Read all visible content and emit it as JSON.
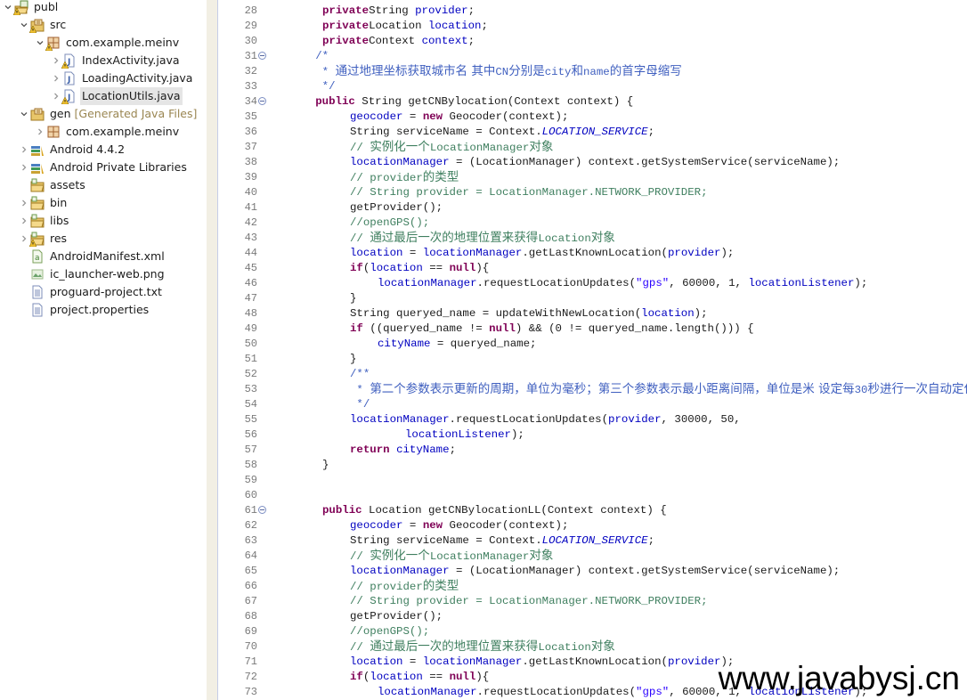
{
  "explorer": {
    "items": [
      {
        "label": "publ",
        "decoration": "",
        "depth": 0,
        "expanded": true,
        "icon": "android-project-icon",
        "warning": true
      },
      {
        "label": "src",
        "decoration": "",
        "depth": 1,
        "expanded": true,
        "icon": "source-folder-icon",
        "warning": true
      },
      {
        "label": "com.example.meinv",
        "decoration": "",
        "depth": 2,
        "expanded": true,
        "icon": "package-icon",
        "warning": true
      },
      {
        "label": "IndexActivity.java",
        "decoration": "",
        "depth": 3,
        "expanded": false,
        "icon": "java-file-icon",
        "warning": true
      },
      {
        "label": "LoadingActivity.java",
        "decoration": "",
        "depth": 3,
        "expanded": false,
        "icon": "java-file-icon",
        "warning": false
      },
      {
        "label": "LocationUtils.java",
        "decoration": "",
        "depth": 3,
        "expanded": false,
        "icon": "java-file-icon",
        "warning": true,
        "selected": true
      },
      {
        "label": "gen",
        "decoration": "[Generated Java Files]",
        "depth": 1,
        "expanded": true,
        "icon": "source-folder-icon",
        "warning": false
      },
      {
        "label": "com.example.meinv",
        "decoration": "",
        "depth": 2,
        "expanded": false,
        "icon": "package-icon",
        "warning": false
      },
      {
        "label": "Android 4.4.2",
        "decoration": "",
        "depth": 1,
        "expanded": false,
        "icon": "library-icon",
        "warning": false
      },
      {
        "label": "Android Private Libraries",
        "decoration": "",
        "depth": 1,
        "expanded": false,
        "icon": "library-icon",
        "warning": false
      },
      {
        "label": "assets",
        "decoration": "",
        "depth": 1,
        "expanded": null,
        "icon": "folder-icon",
        "warning": false
      },
      {
        "label": "bin",
        "decoration": "",
        "depth": 1,
        "expanded": false,
        "icon": "folder-icon",
        "warning": false
      },
      {
        "label": "libs",
        "decoration": "",
        "depth": 1,
        "expanded": false,
        "icon": "folder-icon",
        "warning": false
      },
      {
        "label": "res",
        "decoration": "",
        "depth": 1,
        "expanded": false,
        "icon": "folder-icon",
        "warning": true
      },
      {
        "label": "AndroidManifest.xml",
        "decoration": "",
        "depth": 1,
        "expanded": null,
        "icon": "xml-file-icon",
        "warning": false
      },
      {
        "label": "ic_launcher-web.png",
        "decoration": "",
        "depth": 1,
        "expanded": null,
        "icon": "image-file-icon",
        "warning": false
      },
      {
        "label": "proguard-project.txt",
        "decoration": "",
        "depth": 1,
        "expanded": null,
        "icon": "text-file-icon",
        "warning": false
      },
      {
        "label": "project.properties",
        "decoration": "",
        "depth": 1,
        "expanded": null,
        "icon": "text-file-icon",
        "warning": false
      }
    ]
  },
  "editor": {
    "lines": [
      {
        "n": "28",
        "fold": false,
        "indent": 1,
        "tokens": [
          [
            "kw",
            "private"
          ],
          [
            "",
            "String "
          ],
          [
            "fld",
            "provider"
          ],
          [
            "",
            ";"
          ]
        ]
      },
      {
        "n": "29",
        "fold": false,
        "indent": 1,
        "tokens": [
          [
            "kw",
            "private"
          ],
          [
            "",
            "Location "
          ],
          [
            "fld",
            "location"
          ],
          [
            "",
            ";"
          ]
        ]
      },
      {
        "n": "30",
        "fold": false,
        "indent": 1,
        "tokens": [
          [
            "kw",
            "private"
          ],
          [
            "",
            "Context "
          ],
          [
            "fld",
            "context"
          ],
          [
            "",
            ";"
          ]
        ]
      },
      {
        "n": "31",
        "fold": true,
        "indent": 0.75,
        "tokens": [
          [
            "jd",
            "/*"
          ]
        ]
      },
      {
        "n": "32",
        "fold": false,
        "indent": 0.75,
        "tokens": [
          [
            "jd",
            " * "
          ],
          [
            "jdcjk",
            "通过地理坐标获取城市名 其中"
          ],
          [
            "jd",
            "CN"
          ],
          [
            "jdcjk",
            "分别是"
          ],
          [
            "jd",
            "city"
          ],
          [
            "jdcjk",
            "和"
          ],
          [
            "jd",
            "name"
          ],
          [
            "jdcjk",
            "的首字母缩写"
          ]
        ]
      },
      {
        "n": "33",
        "fold": false,
        "indent": 0.75,
        "tokens": [
          [
            "jd",
            " */"
          ]
        ]
      },
      {
        "n": "34",
        "fold": true,
        "indent": 0.75,
        "tokens": [
          [
            "kw",
            "public"
          ],
          [
            "",
            " String getCNBylocation(Context context) {"
          ]
        ]
      },
      {
        "n": "35",
        "fold": false,
        "indent": 2,
        "tokens": [
          [
            "fld",
            "geocoder"
          ],
          [
            "",
            " = "
          ],
          [
            "kw",
            "new"
          ],
          [
            "",
            " Geocoder(context);"
          ]
        ]
      },
      {
        "n": "36",
        "fold": false,
        "indent": 2,
        "tokens": [
          [
            "",
            "String serviceName = Context."
          ],
          [
            "sfld",
            "LOCATION_SERVICE"
          ],
          [
            "",
            ";"
          ]
        ]
      },
      {
        "n": "37",
        "fold": false,
        "indent": 2,
        "tokens": [
          [
            "cm",
            "// "
          ],
          [
            "cmcjk",
            "实例化一个"
          ],
          [
            "cm",
            "LocationManager"
          ],
          [
            "cmcjk",
            "对象"
          ]
        ]
      },
      {
        "n": "38",
        "fold": false,
        "indent": 2,
        "tokens": [
          [
            "fld",
            "locationManager"
          ],
          [
            "",
            " = (LocationManager) context.getSystemService(serviceName);"
          ]
        ]
      },
      {
        "n": "39",
        "fold": false,
        "indent": 2,
        "tokens": [
          [
            "cm",
            "// provider"
          ],
          [
            "cmcjk",
            "的类型"
          ]
        ]
      },
      {
        "n": "40",
        "fold": false,
        "indent": 2,
        "tokens": [
          [
            "cm",
            "// String provider = LocationManager.NETWORK_PROVIDER;"
          ]
        ]
      },
      {
        "n": "41",
        "fold": false,
        "indent": 2,
        "tokens": [
          [
            "",
            "getProvider();"
          ]
        ]
      },
      {
        "n": "42",
        "fold": false,
        "indent": 2,
        "tokens": [
          [
            "cm",
            "//openGPS();"
          ]
        ]
      },
      {
        "n": "43",
        "fold": false,
        "indent": 2,
        "tokens": [
          [
            "cm",
            "// "
          ],
          [
            "cmcjk",
            "通过最后一次的地理位置来获得"
          ],
          [
            "cm",
            "Location"
          ],
          [
            "cmcjk",
            "对象"
          ]
        ]
      },
      {
        "n": "44",
        "fold": false,
        "indent": 2,
        "tokens": [
          [
            "fld",
            "location"
          ],
          [
            "",
            " = "
          ],
          [
            "fld",
            "locationManager"
          ],
          [
            "",
            ".getLastKnownLocation("
          ],
          [
            "fld",
            "provider"
          ],
          [
            "",
            ");"
          ]
        ]
      },
      {
        "n": "45",
        "fold": false,
        "indent": 2,
        "tokens": [
          [
            "kw",
            "if"
          ],
          [
            "",
            "("
          ],
          [
            "fld",
            "location"
          ],
          [
            "",
            " == "
          ],
          [
            "kw",
            "null"
          ],
          [
            "",
            "){"
          ]
        ]
      },
      {
        "n": "46",
        "fold": false,
        "indent": 3,
        "tokens": [
          [
            "fld",
            "locationManager"
          ],
          [
            "",
            ".requestLocationUpdates("
          ],
          [
            "str",
            "\"gps\""
          ],
          [
            "",
            ", 60000, 1, "
          ],
          [
            "fld",
            "locationListener"
          ],
          [
            "",
            ");"
          ]
        ]
      },
      {
        "n": "47",
        "fold": false,
        "indent": 2,
        "tokens": [
          [
            "",
            "}"
          ]
        ]
      },
      {
        "n": "48",
        "fold": false,
        "indent": 2,
        "tokens": [
          [
            "",
            "String queryed_name = updateWithNewLocation("
          ],
          [
            "fld",
            "location"
          ],
          [
            "",
            ");"
          ]
        ]
      },
      {
        "n": "49",
        "fold": false,
        "indent": 2,
        "tokens": [
          [
            "kw",
            "if"
          ],
          [
            "",
            " ((queryed_name != "
          ],
          [
            "kw",
            "null"
          ],
          [
            "",
            ") && (0 != queryed_name.length())) {"
          ]
        ]
      },
      {
        "n": "50",
        "fold": false,
        "indent": 3,
        "tokens": [
          [
            "fld",
            "cityName"
          ],
          [
            "",
            " = queryed_name;"
          ]
        ]
      },
      {
        "n": "51",
        "fold": false,
        "indent": 2,
        "tokens": [
          [
            "",
            "}"
          ]
        ]
      },
      {
        "n": "52",
        "fold": false,
        "indent": 2,
        "tokens": [
          [
            "jd",
            "/**"
          ]
        ]
      },
      {
        "n": "53",
        "fold": false,
        "indent": 2,
        "tokens": [
          [
            "jd",
            " * "
          ],
          [
            "jdcjk",
            "第二个参数表示更新的周期，单位为毫秒；第三个参数表示最小距离间隔，单位是米 设定每"
          ],
          [
            "jd",
            "30"
          ],
          [
            "jdcjk",
            "秒进行一次自动定位"
          ]
        ]
      },
      {
        "n": "54",
        "fold": false,
        "indent": 2,
        "tokens": [
          [
            "jd",
            " */"
          ]
        ]
      },
      {
        "n": "55",
        "fold": false,
        "indent": 2,
        "tokens": [
          [
            "fld",
            "locationManager"
          ],
          [
            "",
            ".requestLocationUpdates("
          ],
          [
            "fld",
            "provider"
          ],
          [
            "",
            ", 30000, 50,"
          ]
        ]
      },
      {
        "n": "56",
        "fold": false,
        "indent": 4,
        "tokens": [
          [
            "fld",
            "locationListener"
          ],
          [
            "",
            ");"
          ]
        ]
      },
      {
        "n": "57",
        "fold": false,
        "indent": 2,
        "tokens": [
          [
            "kw",
            "return"
          ],
          [
            " ",
            ""
          ],
          [
            "fld",
            "cityName"
          ],
          [
            "",
            ";"
          ]
        ]
      },
      {
        "n": "58",
        "fold": false,
        "indent": 1,
        "tokens": [
          [
            "",
            "}"
          ]
        ]
      },
      {
        "n": "59",
        "fold": false,
        "indent": 0,
        "tokens": []
      },
      {
        "n": "60",
        "fold": false,
        "indent": 0,
        "tokens": []
      },
      {
        "n": "61",
        "fold": true,
        "indent": 1,
        "tokens": [
          [
            "kw",
            "public"
          ],
          [
            "",
            " Location getCNBylocationLL(Context context) {"
          ]
        ]
      },
      {
        "n": "62",
        "fold": false,
        "indent": 2,
        "tokens": [
          [
            "fld",
            "geocoder"
          ],
          [
            "",
            " = "
          ],
          [
            "kw",
            "new"
          ],
          [
            "",
            " Geocoder(context);"
          ]
        ]
      },
      {
        "n": "63",
        "fold": false,
        "indent": 2,
        "tokens": [
          [
            "",
            "String serviceName = Context."
          ],
          [
            "sfld",
            "LOCATION_SERVICE"
          ],
          [
            "",
            ";"
          ]
        ]
      },
      {
        "n": "64",
        "fold": false,
        "indent": 2,
        "tokens": [
          [
            "cm",
            "// "
          ],
          [
            "cmcjk",
            "实例化一个"
          ],
          [
            "cm",
            "LocationManager"
          ],
          [
            "cmcjk",
            "对象"
          ]
        ]
      },
      {
        "n": "65",
        "fold": false,
        "indent": 2,
        "tokens": [
          [
            "fld",
            "locationManager"
          ],
          [
            "",
            " = (LocationManager) context.getSystemService(serviceName);"
          ]
        ]
      },
      {
        "n": "66",
        "fold": false,
        "indent": 2,
        "tokens": [
          [
            "cm",
            "// provider"
          ],
          [
            "cmcjk",
            "的类型"
          ]
        ]
      },
      {
        "n": "67",
        "fold": false,
        "indent": 2,
        "tokens": [
          [
            "cm",
            "// String provider = LocationManager.NETWORK_PROVIDER;"
          ]
        ]
      },
      {
        "n": "68",
        "fold": false,
        "indent": 2,
        "tokens": [
          [
            "",
            "getProvider();"
          ]
        ]
      },
      {
        "n": "69",
        "fold": false,
        "indent": 2,
        "tokens": [
          [
            "cm",
            "//openGPS();"
          ]
        ]
      },
      {
        "n": "70",
        "fold": false,
        "indent": 2,
        "tokens": [
          [
            "cm",
            "// "
          ],
          [
            "cmcjk",
            "通过最后一次的地理位置来获得"
          ],
          [
            "cm",
            "Location"
          ],
          [
            "cmcjk",
            "对象"
          ]
        ]
      },
      {
        "n": "71",
        "fold": false,
        "indent": 2,
        "tokens": [
          [
            "fld",
            "location"
          ],
          [
            "",
            " = "
          ],
          [
            "fld",
            "locationManager"
          ],
          [
            "",
            ".getLastKnownLocation("
          ],
          [
            "fld",
            "provider"
          ],
          [
            "",
            ");"
          ]
        ]
      },
      {
        "n": "72",
        "fold": false,
        "indent": 2,
        "tokens": [
          [
            "kw",
            "if"
          ],
          [
            "",
            "("
          ],
          [
            "fld",
            "location"
          ],
          [
            "",
            " == "
          ],
          [
            "kw",
            "null"
          ],
          [
            "",
            "){"
          ]
        ]
      },
      {
        "n": "73",
        "fold": false,
        "indent": 3,
        "tokens": [
          [
            "fld",
            "locationManager"
          ],
          [
            "",
            ".requestLocationUpdates("
          ],
          [
            "str",
            "\"gps\""
          ],
          [
            "",
            ", 60000, 1, "
          ],
          [
            "fld",
            "locationListener"
          ],
          [
            "",
            ");"
          ]
        ]
      }
    ]
  },
  "watermark": "www.javabysj.cn",
  "colors": {
    "keyword": "#7f0055",
    "field": "#0000c0",
    "comment": "#3f7f5f",
    "javadoc": "#3f5fbf",
    "string": "#2a00ff",
    "line_number": "#7a7a7a",
    "selection": "#e5e5e5"
  }
}
